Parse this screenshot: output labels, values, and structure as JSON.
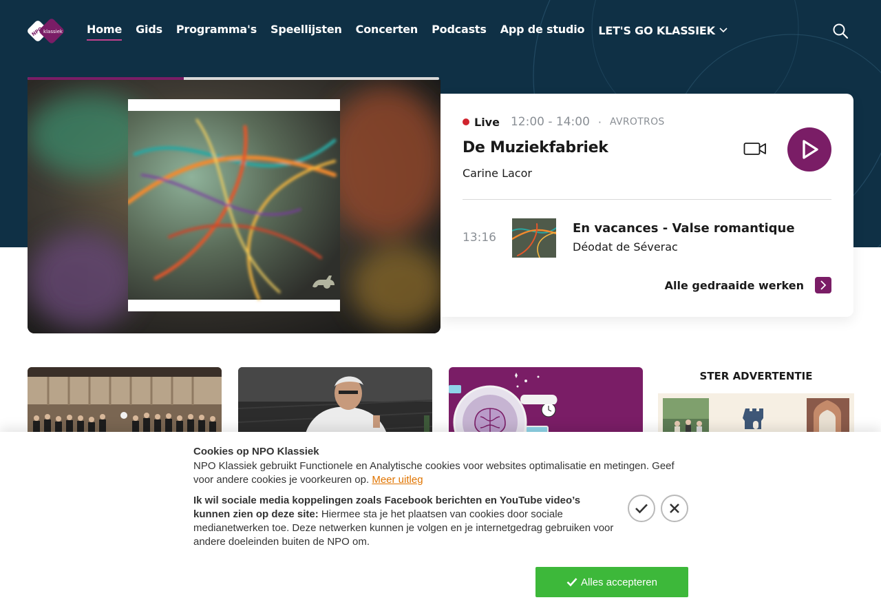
{
  "nav": {
    "logo_alt": "NPO Klassiek",
    "logo_text_top": "NPO",
    "logo_text_bottom": "klassiek",
    "items": [
      {
        "label": "Home",
        "active": true
      },
      {
        "label": "Gids"
      },
      {
        "label": "Programma's"
      },
      {
        "label": "Speellijsten"
      },
      {
        "label": "Concerten"
      },
      {
        "label": "Podcasts"
      },
      {
        "label": "App de studio"
      },
      {
        "label": "LET'S GO KLASSIEK",
        "has_dropdown": true
      }
    ],
    "search_icon": "search-icon"
  },
  "player": {
    "progress": 0.38,
    "live_label": "Live",
    "time_range": "12:00 - 14:00",
    "separator": "·",
    "broadcaster": "AVROTROS",
    "show_title": "De Muziekfabriek",
    "presenter": "Carine Lacor",
    "video_icon": "video-camera-icon",
    "play_icon": "play-icon"
  },
  "now_playing": {
    "time": "13:16",
    "title": "En vacances - Valse romantique",
    "composer": "Déodat de Séverac",
    "all_works_label": "Alle gedraaide werken",
    "arrow_icon": "chevron-right-icon"
  },
  "tiles": [
    {
      "name": "choir-concert"
    },
    {
      "name": "conductor-portrait"
    },
    {
      "name": "brain-illustration"
    }
  ],
  "ad": {
    "title": "STER ADVERTENTIE"
  },
  "cookie": {
    "title": "Cookies op NPO Klassiek",
    "text": "NPO Klassiek gebruikt Functionele en Analytische cookies voor websites optimalisatie en metingen. Geef voor andere cookies je voorkeuren op. ",
    "link": "Meer uitleg",
    "social_bold": "Ik wil sociale media koppelingen zoals Facebook berichten en YouTube video’s kunnen zien op deze site:",
    "social_text": " Hiermee sta je het plaatsen van cookies door sociale medianetwerken toe. Deze netwerken kunnen je volgen en je internetgedrag gebruiken voor andere doeleinden buiten de NPO om.",
    "accept_all": "Alles accepteren",
    "colors": {
      "accept": "#3db83a",
      "link": "#e07400"
    }
  },
  "colors": {
    "hero_bg": "#0f3045",
    "brand_purple": "#7a1d66",
    "live_red": "#d0242e"
  }
}
